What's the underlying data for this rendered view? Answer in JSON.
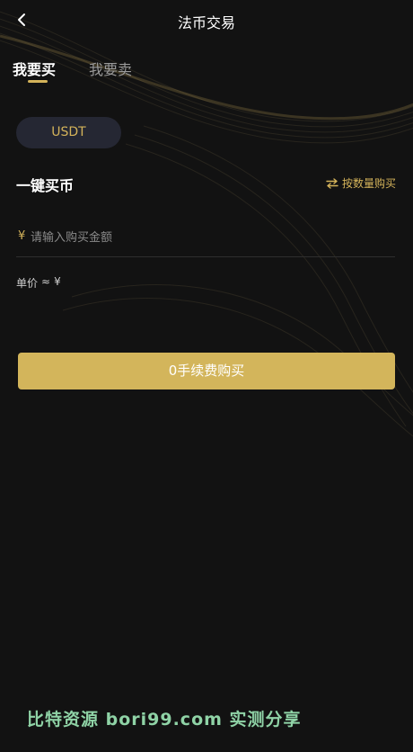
{
  "header": {
    "title": "法币交易",
    "back_icon": "chevron-left-icon"
  },
  "tabs": [
    {
      "label": "我要买",
      "active": true
    },
    {
      "label": "我要卖",
      "active": false
    }
  ],
  "coin": {
    "selected": "USDT"
  },
  "quick_buy": {
    "title": "一键买币",
    "switch_label": "按数量购买",
    "switch_icon": "swap-arrows-icon"
  },
  "amount": {
    "currency_symbol": "¥",
    "placeholder": "请输入购买金额",
    "value": ""
  },
  "unit_price": {
    "label": "单价",
    "approx": "≈",
    "currency": "¥",
    "value": ""
  },
  "submit": {
    "label": "0手续费购买"
  },
  "watermark": {
    "text": "比特资源 bori99.com 实测分享"
  },
  "colors": {
    "background": "#121212",
    "accent": "#d4b35a",
    "button": "#d3b55b",
    "pill": "#252733",
    "watermark": "#8fd3a6"
  }
}
